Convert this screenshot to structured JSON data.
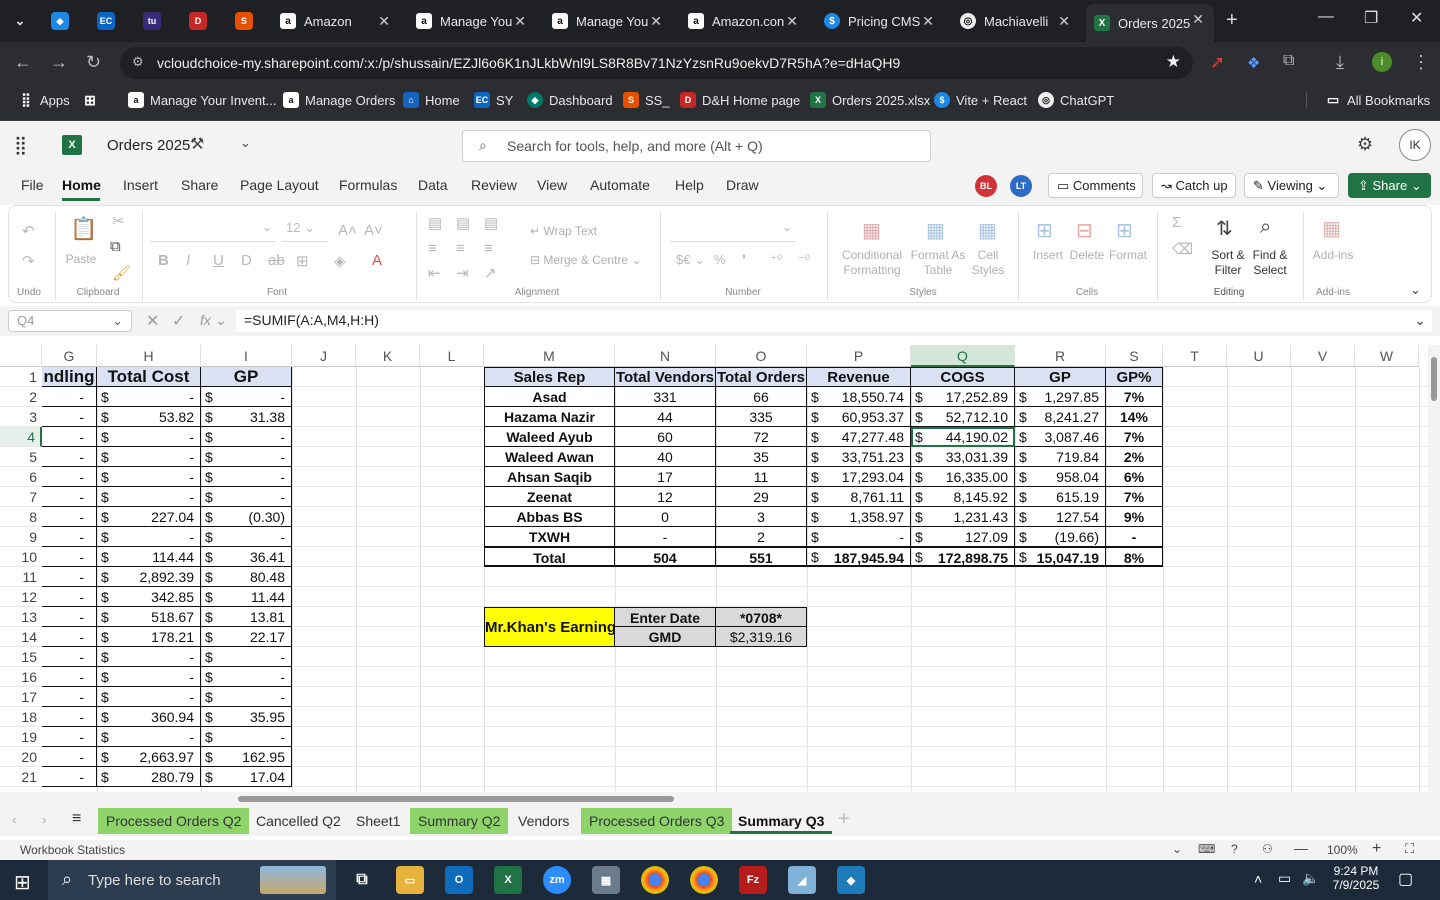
{
  "browser": {
    "tabs": [
      {
        "title": "Amazon",
        "favicon": "amazon-icon"
      },
      {
        "title": "Manage You",
        "favicon": "amazon-icon"
      },
      {
        "title": "Manage You",
        "favicon": "amazon-icon"
      },
      {
        "title": "Amazon.con",
        "favicon": "amazon-icon"
      },
      {
        "title": "Pricing CMS",
        "favicon": "dollar-icon"
      },
      {
        "title": "Machiavelli",
        "favicon": "openai-icon"
      },
      {
        "title": "Orders 2025",
        "favicon": "excel-icon"
      }
    ],
    "url": "vcloudchoice-my.sharepoint.com/:x:/p/shussain/EZJl6o6K1nJLkbWnl9LS8R8Bv71NzYzsnRu9oekvD7R5hA?e=dHaQH9",
    "bookmarks": [
      "Apps",
      "Manage Your Invent...",
      "Manage Orders",
      "Home",
      "SY",
      "Dashboard",
      "SS_",
      "D&H Home page",
      "Orders 2025.xlsx",
      "Vite + React",
      "ChatGPT"
    ],
    "all_bookmarks": "All Bookmarks"
  },
  "excel": {
    "doc_title": "Orders 2025",
    "search_placeholder": "Search for tools, help, and more (Alt + Q)",
    "user_initials": "IK",
    "menu": [
      "File",
      "Home",
      "Insert",
      "Share",
      "Page Layout",
      "Formulas",
      "Data",
      "Review",
      "View",
      "Automate",
      "Help",
      "Draw"
    ],
    "avatars": [
      "BL",
      "LT"
    ],
    "comments_label": "Comments",
    "catchup_label": "Catch up",
    "viewing_label": "Viewing",
    "share_label": "Share",
    "ribbon": {
      "undo_group": "Undo",
      "paste": "Paste",
      "clipboard_group": "Clipboard",
      "font_size": "12",
      "font_group": "Font",
      "wrap_text": "Wrap Text",
      "merge_centre": "Merge & Centre",
      "alignment_group": "Alignment",
      "number_group": "Number",
      "conditional_formatting": "Conditional Formatting",
      "format_as_table": "Format As Table",
      "cell_styles": "Cell Styles",
      "styles_group": "Styles",
      "insert": "Insert",
      "delete": "Delete",
      "format": "Format",
      "cells_group": "Cells",
      "sort_filter": "Sort & Filter",
      "find_select": "Find & Select",
      "editing_group": "Editing",
      "addins": "Add-ins",
      "addins_group": "Add-ins"
    },
    "namebox": "Q4",
    "formula": "=SUMIF(A:A,M4,H:H)",
    "columns": [
      "G",
      "H",
      "I",
      "J",
      "K",
      "L",
      "M",
      "N",
      "O",
      "P",
      "Q",
      "R",
      "S",
      "T",
      "U",
      "V",
      "W"
    ],
    "rows": [
      "1",
      "2",
      "3",
      "4",
      "5",
      "6",
      "7",
      "8",
      "9",
      "10",
      "11",
      "12",
      "13",
      "14",
      "15",
      "16",
      "17",
      "18",
      "19",
      "20",
      "21"
    ],
    "left_table": {
      "headers": [
        "ndling",
        "Total Cost",
        "GP"
      ],
      "rows": [
        [
          "-",
          "-",
          "-"
        ],
        [
          "-",
          "53.82",
          "31.38"
        ],
        [
          "-",
          "-",
          "-"
        ],
        [
          "-",
          "-",
          "-"
        ],
        [
          "-",
          "-",
          "-"
        ],
        [
          "-",
          "-",
          "-"
        ],
        [
          "-",
          "227.04",
          "(0.30)"
        ],
        [
          "-",
          "-",
          "-"
        ],
        [
          "-",
          "114.44",
          "36.41"
        ],
        [
          "-",
          "2,892.39",
          "80.48"
        ],
        [
          "-",
          "342.85",
          "11.44"
        ],
        [
          "-",
          "518.67",
          "13.81"
        ],
        [
          "-",
          "178.21",
          "22.17"
        ],
        [
          "-",
          "-",
          "-"
        ],
        [
          "-",
          "-",
          "-"
        ],
        [
          "-",
          "-",
          "-"
        ],
        [
          "-",
          "360.94",
          "35.95"
        ],
        [
          "-",
          "-",
          "-"
        ],
        [
          "-",
          "2,663.97",
          "162.95"
        ],
        [
          "-",
          "280.79",
          "17.04"
        ]
      ]
    },
    "summary": {
      "headers": [
        "Sales Rep",
        "Total Vendors",
        "Total Orders",
        "Revenue",
        "COGS",
        "GP",
        "GP%"
      ],
      "rows": [
        [
          "Asad",
          "331",
          "66",
          "18,550.74",
          "17,252.89",
          "1,297.85",
          "7%"
        ],
        [
          "Hazama Nazir",
          "44",
          "335",
          "60,953.37",
          "52,712.10",
          "8,241.27",
          "14%"
        ],
        [
          "Waleed Ayub",
          "60",
          "72",
          "47,277.48",
          "44,190.02",
          "3,087.46",
          "7%"
        ],
        [
          "Waleed Awan",
          "40",
          "35",
          "33,751.23",
          "33,031.39",
          "719.84",
          "2%"
        ],
        [
          "Ahsan Saqib",
          "17",
          "11",
          "17,293.04",
          "16,335.00",
          "958.04",
          "6%"
        ],
        [
          "Zeenat",
          "12",
          "29",
          "8,761.11",
          "8,145.92",
          "615.19",
          "7%"
        ],
        [
          "Abbas BS",
          "0",
          "3",
          "1,358.97",
          "1,231.43",
          "127.54",
          "9%"
        ],
        [
          "TXWH",
          "-",
          "2",
          "-",
          "127.09",
          "(19.66)",
          "-"
        ],
        [
          "Total",
          "504",
          "551",
          "187,945.94",
          "172,898.75",
          "15,047.19",
          "8%"
        ]
      ]
    },
    "earning": {
      "label": "Mr.Khan's Earning",
      "date_label": "Enter Date",
      "date_value": "*0708*",
      "gmd_label": "GMD",
      "gmd_value": "$2,319.16"
    },
    "sheets": [
      {
        "name": "Processed Orders Q2",
        "green": true
      },
      {
        "name": "Cancelled Q2",
        "green": false
      },
      {
        "name": "Sheet1",
        "green": false
      },
      {
        "name": "Summary Q2",
        "green": true
      },
      {
        "name": "Vendors",
        "green": false
      },
      {
        "name": "Processed Orders Q3",
        "green": true
      },
      {
        "name": "Summary Q3",
        "green": false
      }
    ],
    "status_left": "Workbook Statistics",
    "zoom": "100%"
  },
  "taskbar": {
    "search_placeholder": "Type here to search",
    "time": "9:24 PM",
    "date": "7/9/2025"
  },
  "colors": {
    "accent": "#217346",
    "header_fill": "#d9e1f2",
    "yellow": "#ffff00",
    "grey": "#d9d9d9",
    "green_tab": "#8fd46b"
  }
}
